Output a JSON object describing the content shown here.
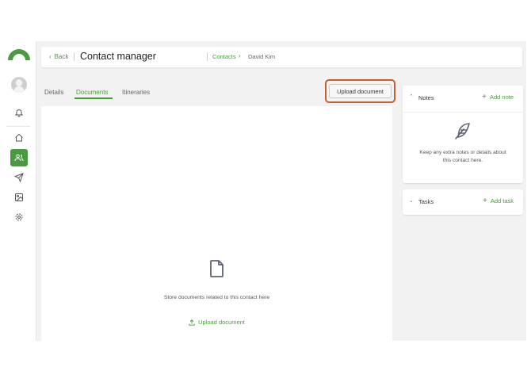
{
  "header": {
    "back_label": "Back",
    "title": "Contact manager",
    "breadcrumb": [
      "Contacts",
      "David Kim"
    ]
  },
  "tabs": [
    {
      "label": "Details",
      "active": false
    },
    {
      "label": "Documents",
      "active": true
    },
    {
      "label": "Itineraries",
      "active": false
    }
  ],
  "toolbar": {
    "upload_label": "Upload document"
  },
  "documents": {
    "empty_text": "Store documents related to this contact here",
    "upload_link": "Upload document"
  },
  "notes": {
    "title": "Notes",
    "add_label": "Add note",
    "empty_text": "Keep any extra notes or details about this contact here."
  },
  "tasks": {
    "title": "Tasks",
    "add_label": "Add task"
  },
  "sidebar": {
    "icons": [
      "bell-icon",
      "home-icon",
      "contacts-icon",
      "send-icon",
      "image-icon",
      "settings-icon"
    ],
    "active": "contacts-icon"
  },
  "colors": {
    "accent": "#4a9a3f",
    "highlight": "#c4602d",
    "background": "#f2f2f2"
  }
}
